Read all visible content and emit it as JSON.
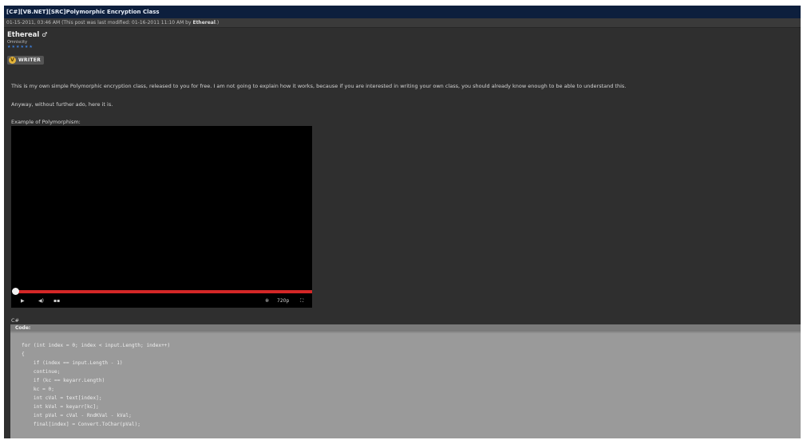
{
  "thread": {
    "title": "[C#][VB.NET][SRC]Polymorphic Encryption Class",
    "date": "01-15-2011, 03:46 AM",
    "modified_prefix": "(This post was last modified: 01-16-2011 11:10 AM by",
    "modified_by": "Ethereal",
    "modified_suffix": ".)"
  },
  "author": {
    "name": "Ethereal",
    "gender_glyph": "♂",
    "rank": "Omniscity",
    "stars": "★★★★★★",
    "badge_glyph": "V",
    "badge_label": "WRITER"
  },
  "post": {
    "paragraph1": "This is my own simple Polymorphic encryption class, released to you for free. I am not going to explain how it works, because if you are interested in writing your own class, you should already know enough to be able to understand this.",
    "paragraph2": "Anyway, without further ado, here it is.",
    "example_label": "Example of Polymorphism:",
    "language_label": "C#"
  },
  "video": {
    "progress": 1.0,
    "play_glyph": "▶",
    "volume_glyph": "◀)",
    "time_glyph": "▪▪",
    "gear_glyph": "✲",
    "quality_glyph": "720p",
    "fullscreen_glyph": "⛶"
  },
  "code": {
    "header": "Code:",
    "lines": [
      "for (int index = 0; index < input.Length; index++)",
      "{",
      "    if (index == input.Length - 1)",
      "    continue;",
      "    if (kc == keyarr.Length)",
      "    kc = 0;",
      "    int cVal = text[index];",
      "    int kVal = keyarr[kc];",
      "    int pVal = cVal - RndKVal - kVal;",
      "    final[index] = Convert.ToChar(pVal);"
    ]
  }
}
